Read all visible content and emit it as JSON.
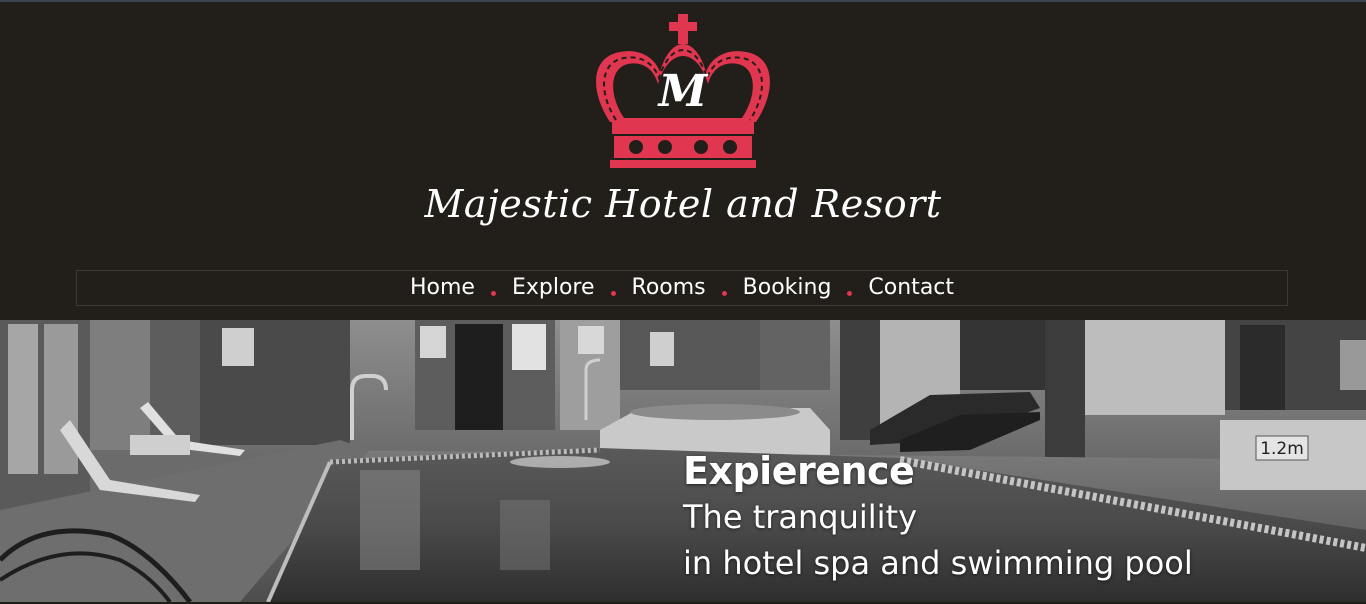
{
  "brand": {
    "logo_monogram": "M",
    "name": "Majestic Hotel and Resort",
    "accent_color": "#e0364f"
  },
  "nav": {
    "items": [
      {
        "label": "Home"
      },
      {
        "label": "Explore"
      },
      {
        "label": "Rooms"
      },
      {
        "label": "Booking"
      },
      {
        "label": "Contact"
      }
    ]
  },
  "hero": {
    "title": "Expierence",
    "line1": "The tranquility",
    "line2": "in hotel spa and swimming pool",
    "sign_depth": "1.2m"
  }
}
